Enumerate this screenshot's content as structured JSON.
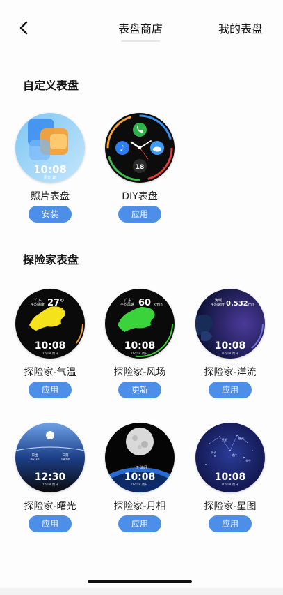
{
  "header": {
    "tab_store": "表盘商店",
    "tab_mine": "我的表盘"
  },
  "sections": {
    "custom": "自定义表盘",
    "explorer": "探险家表盘"
  },
  "tiles": {
    "photo": {
      "name": "照片表盘",
      "button": "安装",
      "time": "10:08",
      "date": "周日 18"
    },
    "diy": {
      "name": "DIY表盘",
      "button": "应用",
      "date_num": "18"
    },
    "temp": {
      "name": "探险家-气温",
      "button": "应用",
      "time": "10:08",
      "date": "02/18 周日",
      "header_label": "广东\n平均温度",
      "value": "27°"
    },
    "wind": {
      "name": "探险家-风场",
      "button": "更新",
      "time": "10:08",
      "date": "02/18 周日",
      "header_label": "广东\n平均风速",
      "value": "60",
      "unit": "km/h"
    },
    "ocean": {
      "name": "探险家-洋流",
      "button": "应用",
      "time": "10:08",
      "date": "02/18 周日",
      "header_label": "海域\n平均速度",
      "value": "0.532",
      "unit": "m/s"
    },
    "dawn": {
      "name": "探险家-曙光",
      "button": "应用",
      "time": "12:30",
      "date": "02/18 周日",
      "sunrise_label": "日出",
      "sunrise": "06:30",
      "sunset_label": "日落",
      "sunset": "18:00"
    },
    "moon": {
      "name": "探险家-月相",
      "button": "应用",
      "time": "10:08",
      "date": "02/18 周日",
      "phase": "十五 满月"
    },
    "star": {
      "name": "探险家-星图",
      "button": "应用",
      "time": "10:08",
      "date": "02/18 周日",
      "labels": [
        "天狼",
        "御夫",
        "双子",
        "猎户",
        "金牛"
      ]
    }
  },
  "colors": {
    "accent": "#4d8fe8",
    "green_map": "#3bd33b",
    "yellow_map": "#f3e21c"
  }
}
